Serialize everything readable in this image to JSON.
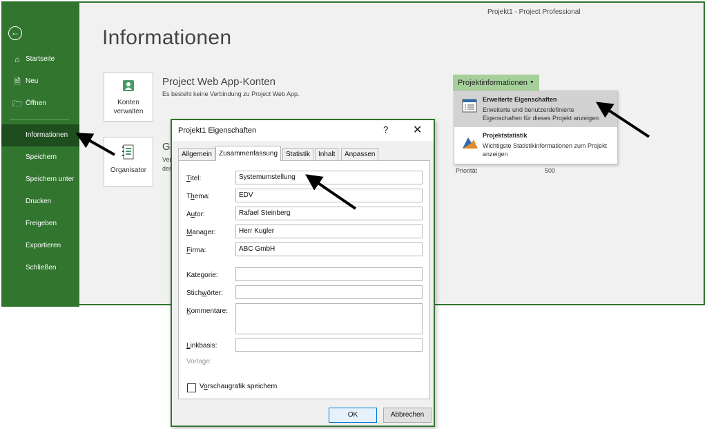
{
  "window": {
    "title": "Projekt1  -  Project Professional",
    "page_title": "Informationen"
  },
  "sidebar": {
    "items": [
      {
        "label": "Startseite",
        "icon": "home-icon"
      },
      {
        "label": "Neu",
        "icon": "new-document-icon"
      },
      {
        "label": "Öffnen",
        "icon": "folder-open-icon"
      },
      {
        "label": "Informationen",
        "active": true
      },
      {
        "label": "Speichern"
      },
      {
        "label": "Speichern unter"
      },
      {
        "label": "Drucken"
      },
      {
        "label": "Freigeben"
      },
      {
        "label": "Exportieren"
      },
      {
        "label": "Schließen"
      }
    ],
    "back_icon": "back-arrow-icon"
  },
  "tiles": {
    "accounts": {
      "label_line1": "Konten",
      "label_line2": "verwalten",
      "icon": "account-icon"
    },
    "organizer": {
      "label": "Organisator",
      "icon": "organizer-icon"
    }
  },
  "web_app": {
    "heading": "Project Web App-Konten",
    "description": "Es besteht keine Verbindung zu Project Web App."
  },
  "partial": {
    "heading": "Gl",
    "desc1": "Ver",
    "desc2": "der"
  },
  "project_info": {
    "button_label": "Projektinformationen",
    "priority_label": "Priorität",
    "priority_value": "500",
    "dropdown": [
      {
        "title": "Erweiterte Eigenschaften",
        "description": "Erweiterte und benutzerdefinierte Eigenschaften für dieses Projekt anzeigen",
        "icon": "properties-icon",
        "highlighted": true
      },
      {
        "title": "Projektstatistik",
        "description": "Wichtigste Statistikinformationen zum Projekt anzeigen",
        "icon": "statistics-icon",
        "highlighted": false
      }
    ]
  },
  "dialog": {
    "title": "Projekt1 Eigenschaften",
    "help": "?",
    "close": "✕",
    "tabs": [
      "Allgemein",
      "Zusammenfassung",
      "Statistik",
      "Inhalt",
      "Anpassen"
    ],
    "active_tab": "Zusammenfassung",
    "fields": {
      "title": {
        "label_pre": "",
        "label_ul": "T",
        "label_post": "itel:",
        "value": "Systemumstellung"
      },
      "subject": {
        "label_pre": "T",
        "label_ul": "h",
        "label_post": "ema:",
        "value": "EDV"
      },
      "author": {
        "label_pre": "A",
        "label_ul": "u",
        "label_post": "tor:",
        "value": "Rafael Steinberg"
      },
      "manager": {
        "label_pre": "",
        "label_ul": "M",
        "label_post": "anager:",
        "value": "Herr Kugler"
      },
      "company": {
        "label_pre": "",
        "label_ul": "F",
        "label_post": "irma:",
        "value": "ABC GmbH"
      },
      "category": {
        "label_pre": "Kate",
        "label_ul": "g",
        "label_post": "orie:",
        "value": ""
      },
      "keywords": {
        "label_pre": "Stich",
        "label_ul": "w",
        "label_post": "örter:",
        "value": ""
      },
      "comments": {
        "label_pre": "",
        "label_ul": "K",
        "label_post": "ommentare:",
        "value": ""
      },
      "hyperlink": {
        "label_pre": "",
        "label_ul": "L",
        "label_post": "inkbasis:",
        "value": ""
      },
      "template": {
        "label": "Vorlage:"
      }
    },
    "preview": {
      "label_pre": "V",
      "label_ul": "o",
      "label_post": "rschaugrafik speichern",
      "checked": false
    },
    "ok": "OK",
    "cancel": "Abbrechen"
  },
  "colors": {
    "sidebar": "#31752f",
    "sidebar_active": "#1e4e1d",
    "project_info_button": "#a6d09a",
    "dropdown_highlight": "#d2d2d2"
  }
}
